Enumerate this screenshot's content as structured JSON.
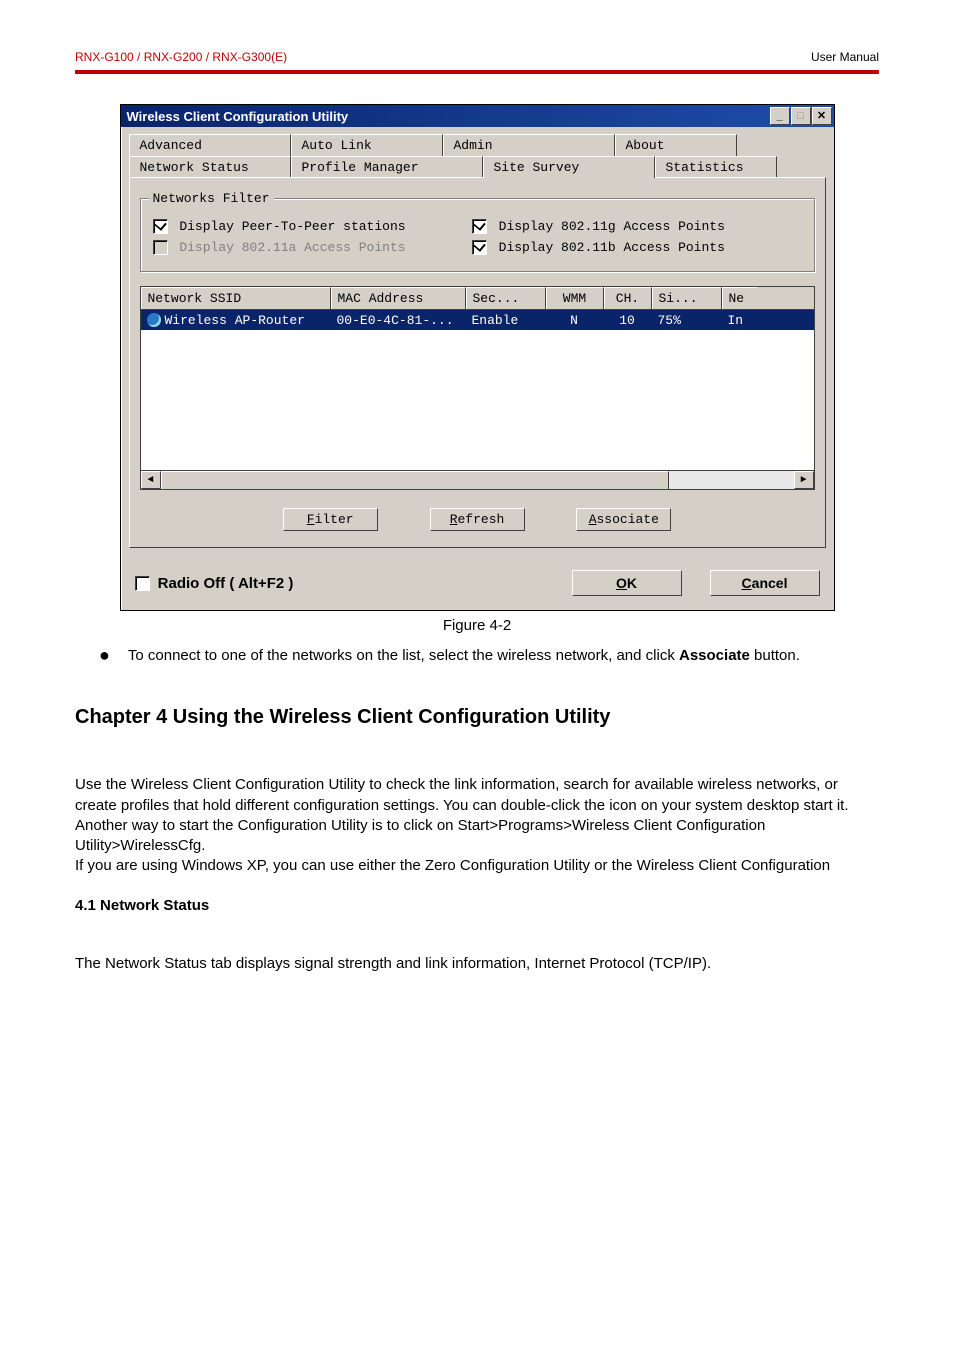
{
  "header": {
    "models": "RNX-G100 / RNX-G200 / RNX-G300(E)",
    "manual": "User Manual"
  },
  "dialog": {
    "title": "Wireless Client Configuration Utility",
    "tabs_row1": [
      "Advanced",
      "Auto Link",
      "Admin",
      "About"
    ],
    "tabs_row2": [
      "Network Status",
      "Profile Manager",
      "Site Survey",
      "Statistics"
    ],
    "group_legend": "Networks Filter",
    "filters": {
      "peer": "Display Peer-To-Peer stations",
      "g": "Display 802.11g Access Points",
      "a": "Display 802.11a Access Points",
      "b": "Display 802.11b Access Points"
    },
    "table": {
      "headers": [
        "Network SSID",
        "MAC Address",
        "Sec...",
        "WMM",
        "CH.",
        "Si...",
        "Ne"
      ],
      "row": {
        "ssid": "Wireless AP-Router",
        "mac": "00-E0-4C-81-...",
        "sec": "Enable",
        "wmm": "N",
        "ch": "10",
        "si": "75%",
        "ne": "In"
      }
    },
    "buttons": {
      "filter": "Filter",
      "refresh": "Refresh",
      "associate": "Associate",
      "ok": "OK",
      "cancel": "Cancel"
    },
    "radio_off": "Radio Off  ( Alt+F2 )"
  },
  "body": {
    "fig": "Figure 4-2",
    "bullet": "To connect to one of the networks on the list, select the wireless network, and click Associate button.",
    "h2": "Chapter 4 Using the Wireless Client Configuration Utility",
    "para": "Use the Wireless Client Configuration Utility to check the link information, search for available wireless networks, or create profiles that hold different configuration settings. You can double-click the icon on your system desktop start it. Another way to start the Configuration Utility is to click on Start>Programs>Wireless Client Configuration Utility>WirelessCfg.\nIf you are using Windows XP, you can use either the Zero Configuration Utility or the Wireless Client Configuration",
    "sub": "4.1 Network Status",
    "para2": "The Network Status tab displays signal strength and link information, Internet Protocol (TCP/IP)."
  }
}
